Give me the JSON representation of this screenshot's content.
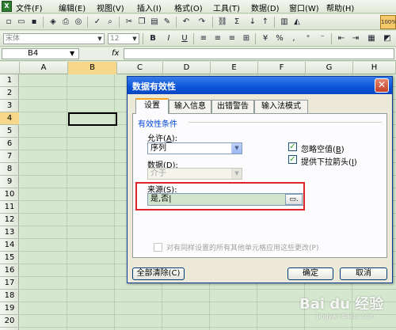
{
  "menubar": {
    "app_icon": "X",
    "items": [
      "文件(F)",
      "编辑(E)",
      "视图(V)",
      "插入(I)",
      "格式(O)",
      "工具(T)",
      "数据(D)",
      "窗口(W)",
      "帮助(H)"
    ]
  },
  "toolbar": {
    "font_name": "宋体",
    "font_size": "12",
    "zoom": "100%",
    "format_icons": [
      "B",
      "I",
      "U"
    ]
  },
  "formula_bar": {
    "name_box": "B4",
    "fx": "fx"
  },
  "grid": {
    "columns": [
      "A",
      "B",
      "C",
      "D",
      "E",
      "F",
      "G",
      "H"
    ],
    "rows": [
      "1",
      "2",
      "3",
      "4",
      "5",
      "6",
      "7",
      "8",
      "9",
      "10",
      "11",
      "12",
      "13",
      "14",
      "15",
      "16",
      "17",
      "18",
      "19",
      "20"
    ]
  },
  "dialog": {
    "title": "数据有效性",
    "close": "✕",
    "tabs": [
      "设置",
      "输入信息",
      "出错警告",
      "输入法模式"
    ],
    "section_title": "有效性条件",
    "allow_label": "允许(",
    "allow_key": "A",
    "allow_value": "序列",
    "data_label": "数据(",
    "data_key": "D",
    "data_value": "介于",
    "ignore_blank_label": "忽略空值(",
    "ignore_blank_key": "B",
    "dropdown_label": "提供下拉箭头(",
    "dropdown_key": "I",
    "source_label": "来源(",
    "source_key": "S",
    "source_value": "是,否|",
    "apply_all_label": "对有同样设置的所有其他单元格应用这些更改(P)",
    "clear_all": "全部清除(C)",
    "ok": "确定",
    "cancel": "取消"
  },
  "watermark": {
    "logo": "Bai du 经验",
    "url": "jingyan.baidu.com"
  },
  "colors": {
    "grid_bg": "#d5e7cf",
    "dialog_title": "#0a54d8",
    "highlight": "#e0222a"
  }
}
